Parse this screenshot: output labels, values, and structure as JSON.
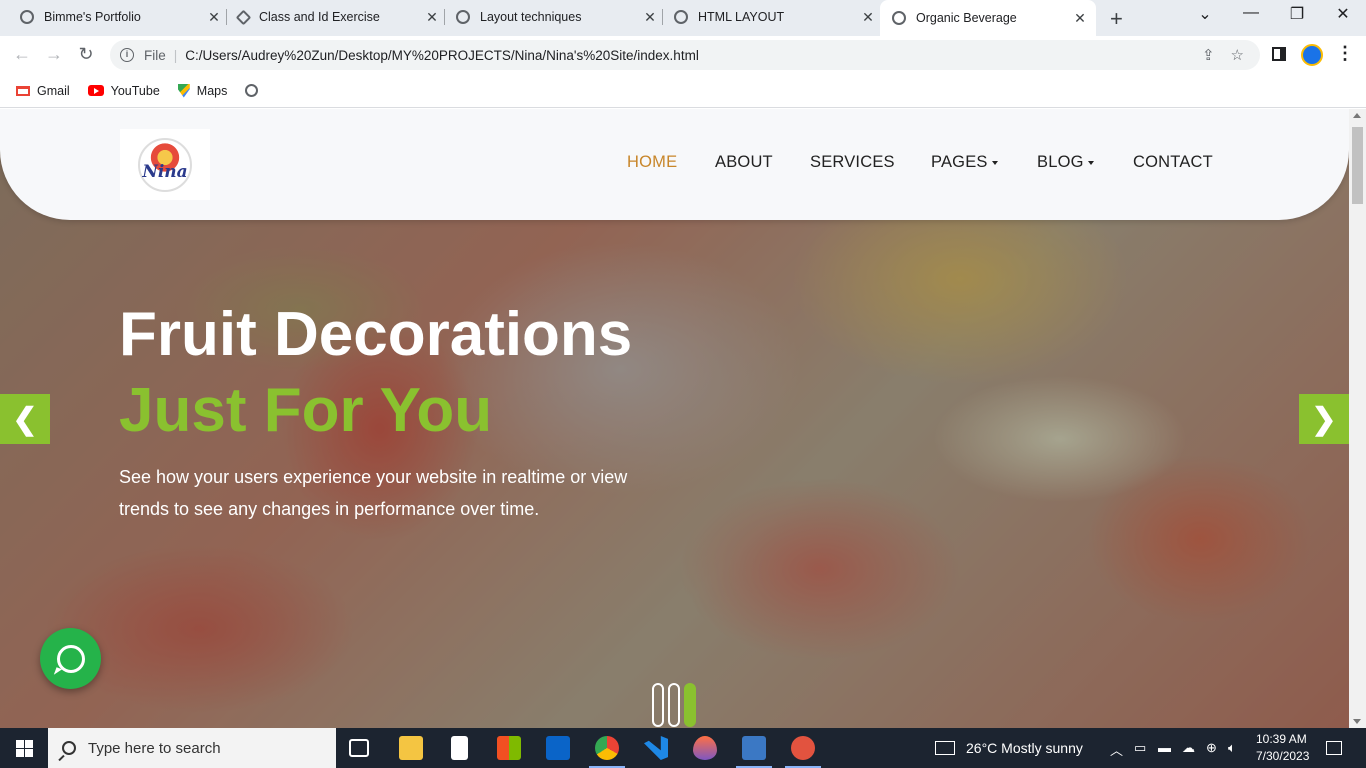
{
  "browser": {
    "tabs": [
      {
        "label": "Bimme's Portfolio",
        "active": false
      },
      {
        "label": "Class and Id Exercise",
        "active": false
      },
      {
        "label": "Layout techniques",
        "active": false
      },
      {
        "label": "HTML LAYOUT",
        "active": false
      },
      {
        "label": "Organic Beverage",
        "active": true
      }
    ],
    "close_glyph": "✕",
    "new_tab_glyph": "+",
    "window_controls": {
      "menu": "⌄",
      "minimize": "—",
      "restore": "❐",
      "close": "✕"
    },
    "nav": {
      "back": "←",
      "forward": "→",
      "reload": "↻"
    },
    "address": {
      "scheme_label": "File",
      "url": "C:/Users/Audrey%20Zun/Desktop/MY%20PROJECTS/Nina/Nina's%20Site/index.html",
      "share_glyph": "⇪",
      "star_glyph": "☆"
    },
    "menu_glyph": "⋮",
    "bookmarks": [
      {
        "label": "Gmail",
        "icon": "gmail-icon"
      },
      {
        "label": "YouTube",
        "icon": "youtube-icon"
      },
      {
        "label": "Maps",
        "icon": "maps-icon"
      }
    ]
  },
  "site": {
    "logo_text": "Nina",
    "menu": [
      {
        "label": "HOME",
        "active": true,
        "dropdown": false
      },
      {
        "label": "ABOUT",
        "active": false,
        "dropdown": false
      },
      {
        "label": "SERVICES",
        "active": false,
        "dropdown": false
      },
      {
        "label": "PAGES",
        "active": false,
        "dropdown": true
      },
      {
        "label": "BLOG",
        "active": false,
        "dropdown": true
      },
      {
        "label": "CONTACT",
        "active": false,
        "dropdown": false
      }
    ],
    "hero": {
      "title_line1": "Fruit Decorations",
      "title_line2": "Just For You",
      "lead": "See how your users experience your website in realtime or view trends to see any changes in performance over time.",
      "prev_glyph": "❮",
      "next_glyph": "❯",
      "slides": 3,
      "active_slide": 3
    },
    "colors": {
      "accent": "#8ac12f",
      "menu_active": "#c8862a",
      "whatsapp": "#25b34a"
    }
  },
  "taskbar": {
    "search_placeholder": "Type here to search",
    "weather": "26°C  Mostly sunny",
    "time": "10:39 AM",
    "date": "7/30/2023",
    "apps": [
      "task-view-icon",
      "file-explorer-icon",
      "notepad-icon",
      "store-icon",
      "mail-icon",
      "chrome-icon",
      "vscode-icon",
      "paint-icon",
      "photos-icon",
      "snipping-tool-icon"
    ]
  }
}
